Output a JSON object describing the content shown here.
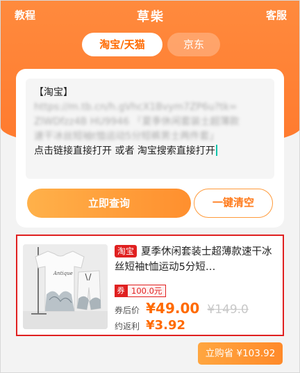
{
  "header": {
    "left_label": "教程",
    "title": "草柴",
    "right_label": "客服"
  },
  "tabs": [
    {
      "label": "淘宝/天猫",
      "active": true
    },
    {
      "label": "京东",
      "active": false
    }
  ],
  "input": {
    "lines": [
      "【淘宝】",
      "https://m.tb.cn/h.gVhcX1Bvym7ZP6u?tk=",
      "ZlWDfzz4B HU9946 「夏季休闲套装士超薄款",
      "速干冰丝短袖t恤运动5分短裤男士两件套」",
      "点击链接直接打开 或者 淘宝搜索直接打开"
    ]
  },
  "buttons": {
    "query_label": "立即查询",
    "clear_label": "一键清空"
  },
  "product": {
    "platform": "淘宝",
    "title": "夏季休闲套装士超薄款速干冰丝短袖t恤运动5分短…",
    "coupon_label": "券",
    "coupon_value": "100.0元",
    "price_label": "券后价",
    "price": "¥49.00",
    "original_price": "¥149.0",
    "rebate_label": "约返利",
    "rebate": "¥3.92"
  },
  "buy_button": {
    "label": "立购省 ¥103.92"
  },
  "colors": {
    "accent": "#ff7a2e",
    "highlight": "#e02020"
  }
}
